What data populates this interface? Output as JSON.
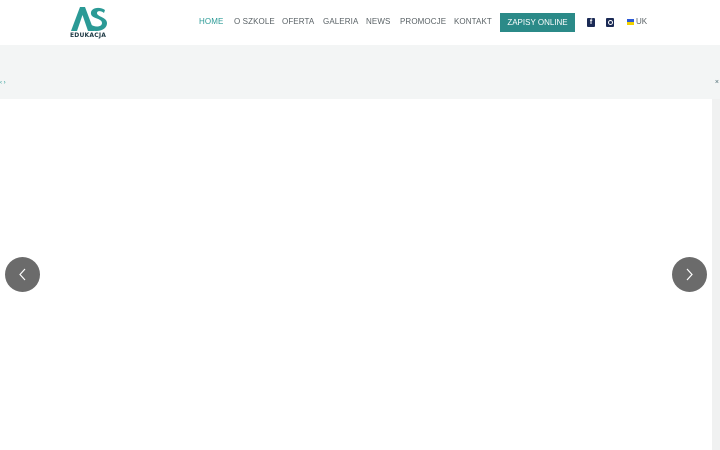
{
  "logo": {
    "mark": "AS",
    "text": "EDUKACJA",
    "color": "#2b9a96"
  },
  "nav": {
    "items": [
      {
        "label": "HOME",
        "active": true
      },
      {
        "label": "O SZKOLE",
        "active": false
      },
      {
        "label": "OFERTA",
        "active": false
      },
      {
        "label": "GALERIA",
        "active": false
      },
      {
        "label": "NEWS",
        "active": false
      },
      {
        "label": "PROMOCJE",
        "active": false
      },
      {
        "label": "KONTAKT",
        "active": false
      }
    ],
    "cta": "ZAPISY ONLINE"
  },
  "social": {
    "facebook": "f",
    "instagram_icon": "instagram-icon"
  },
  "language": {
    "label": "UK",
    "flag_icon": "ukraine-flag-icon"
  },
  "band": {
    "left_marker": "‹ ›",
    "right_marker": "×"
  },
  "slider": {
    "prev_icon": "chevron-left-icon",
    "next_icon": "chevron-right-icon"
  },
  "colors": {
    "accent": "#2b9a96",
    "cta_bg": "#2b8a88",
    "band_bg": "#f3f5f5",
    "arrow_bg": "#6b6b6b"
  }
}
